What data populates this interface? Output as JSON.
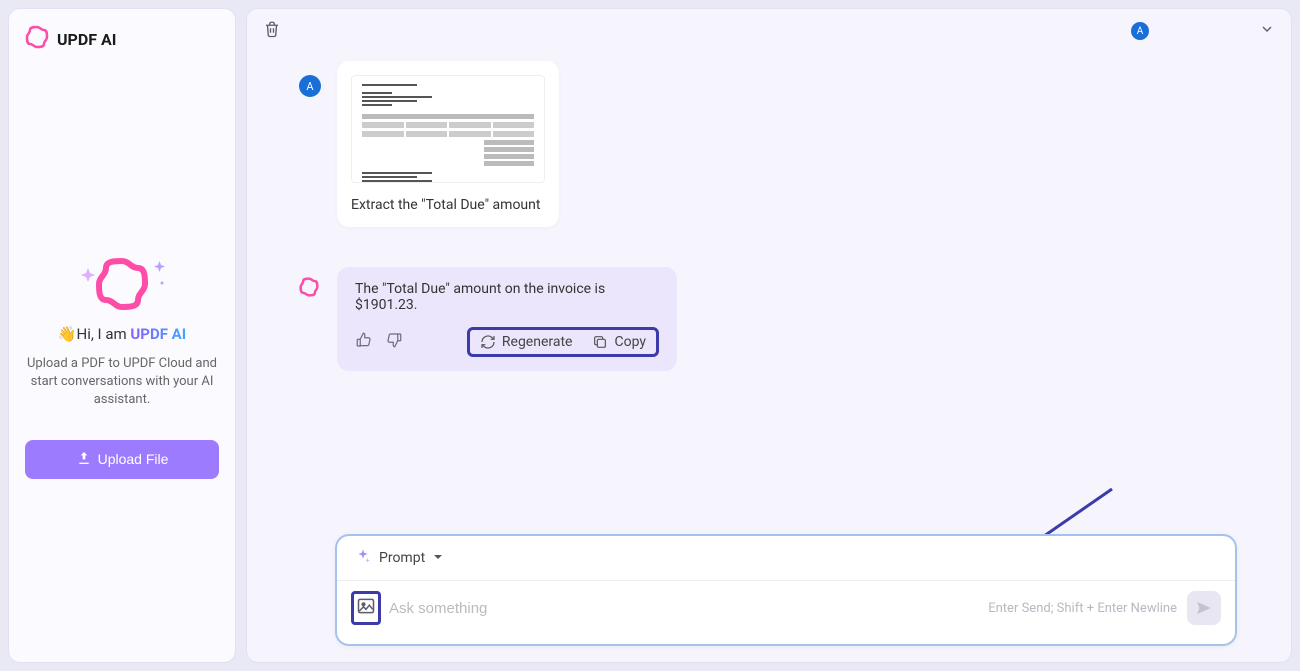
{
  "brand": {
    "title": "UPDF AI"
  },
  "sidebar": {
    "greeting_pre": "👋Hi, I am ",
    "greeting_brand": "UPDF AI",
    "description": "Upload a PDF to UPDF Cloud and start conversations with your AI assistant.",
    "upload_label": "Upload File"
  },
  "topbar": {
    "avatar_letter": "A"
  },
  "chat": {
    "user_avatar": "A",
    "user_message": "Extract the \"Total Due\" amount",
    "ai_reply": "The \"Total Due\" amount on the invoice is $1901.23.",
    "regenerate_label": "Regenerate",
    "copy_label": "Copy"
  },
  "prompt": {
    "label": "Prompt",
    "placeholder": "Ask something",
    "hint": "Enter Send; Shift + Enter Newline"
  }
}
